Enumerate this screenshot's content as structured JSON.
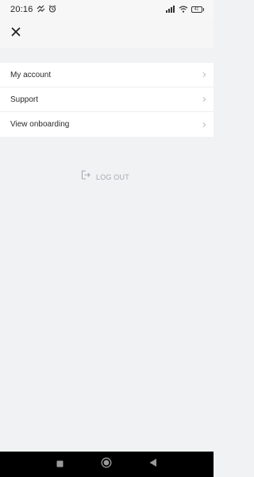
{
  "status_bar": {
    "time": "20:16",
    "battery_level": "41"
  },
  "menu": {
    "items": [
      {
        "label": "My account"
      },
      {
        "label": "Support"
      },
      {
        "label": "View onboarding"
      }
    ]
  },
  "logout": {
    "label": "LOG OUT"
  },
  "icons": {
    "close": "close-icon",
    "chevron": "chevron-right-icon",
    "logout": "logout-icon",
    "nav_recents": "square-icon",
    "nav_home": "circle-icon",
    "nav_back": "triangle-back-icon"
  },
  "colors": {
    "background": "#f1f2f4",
    "menu_background": "#ffffff",
    "muted_text": "#a8a9ae"
  }
}
